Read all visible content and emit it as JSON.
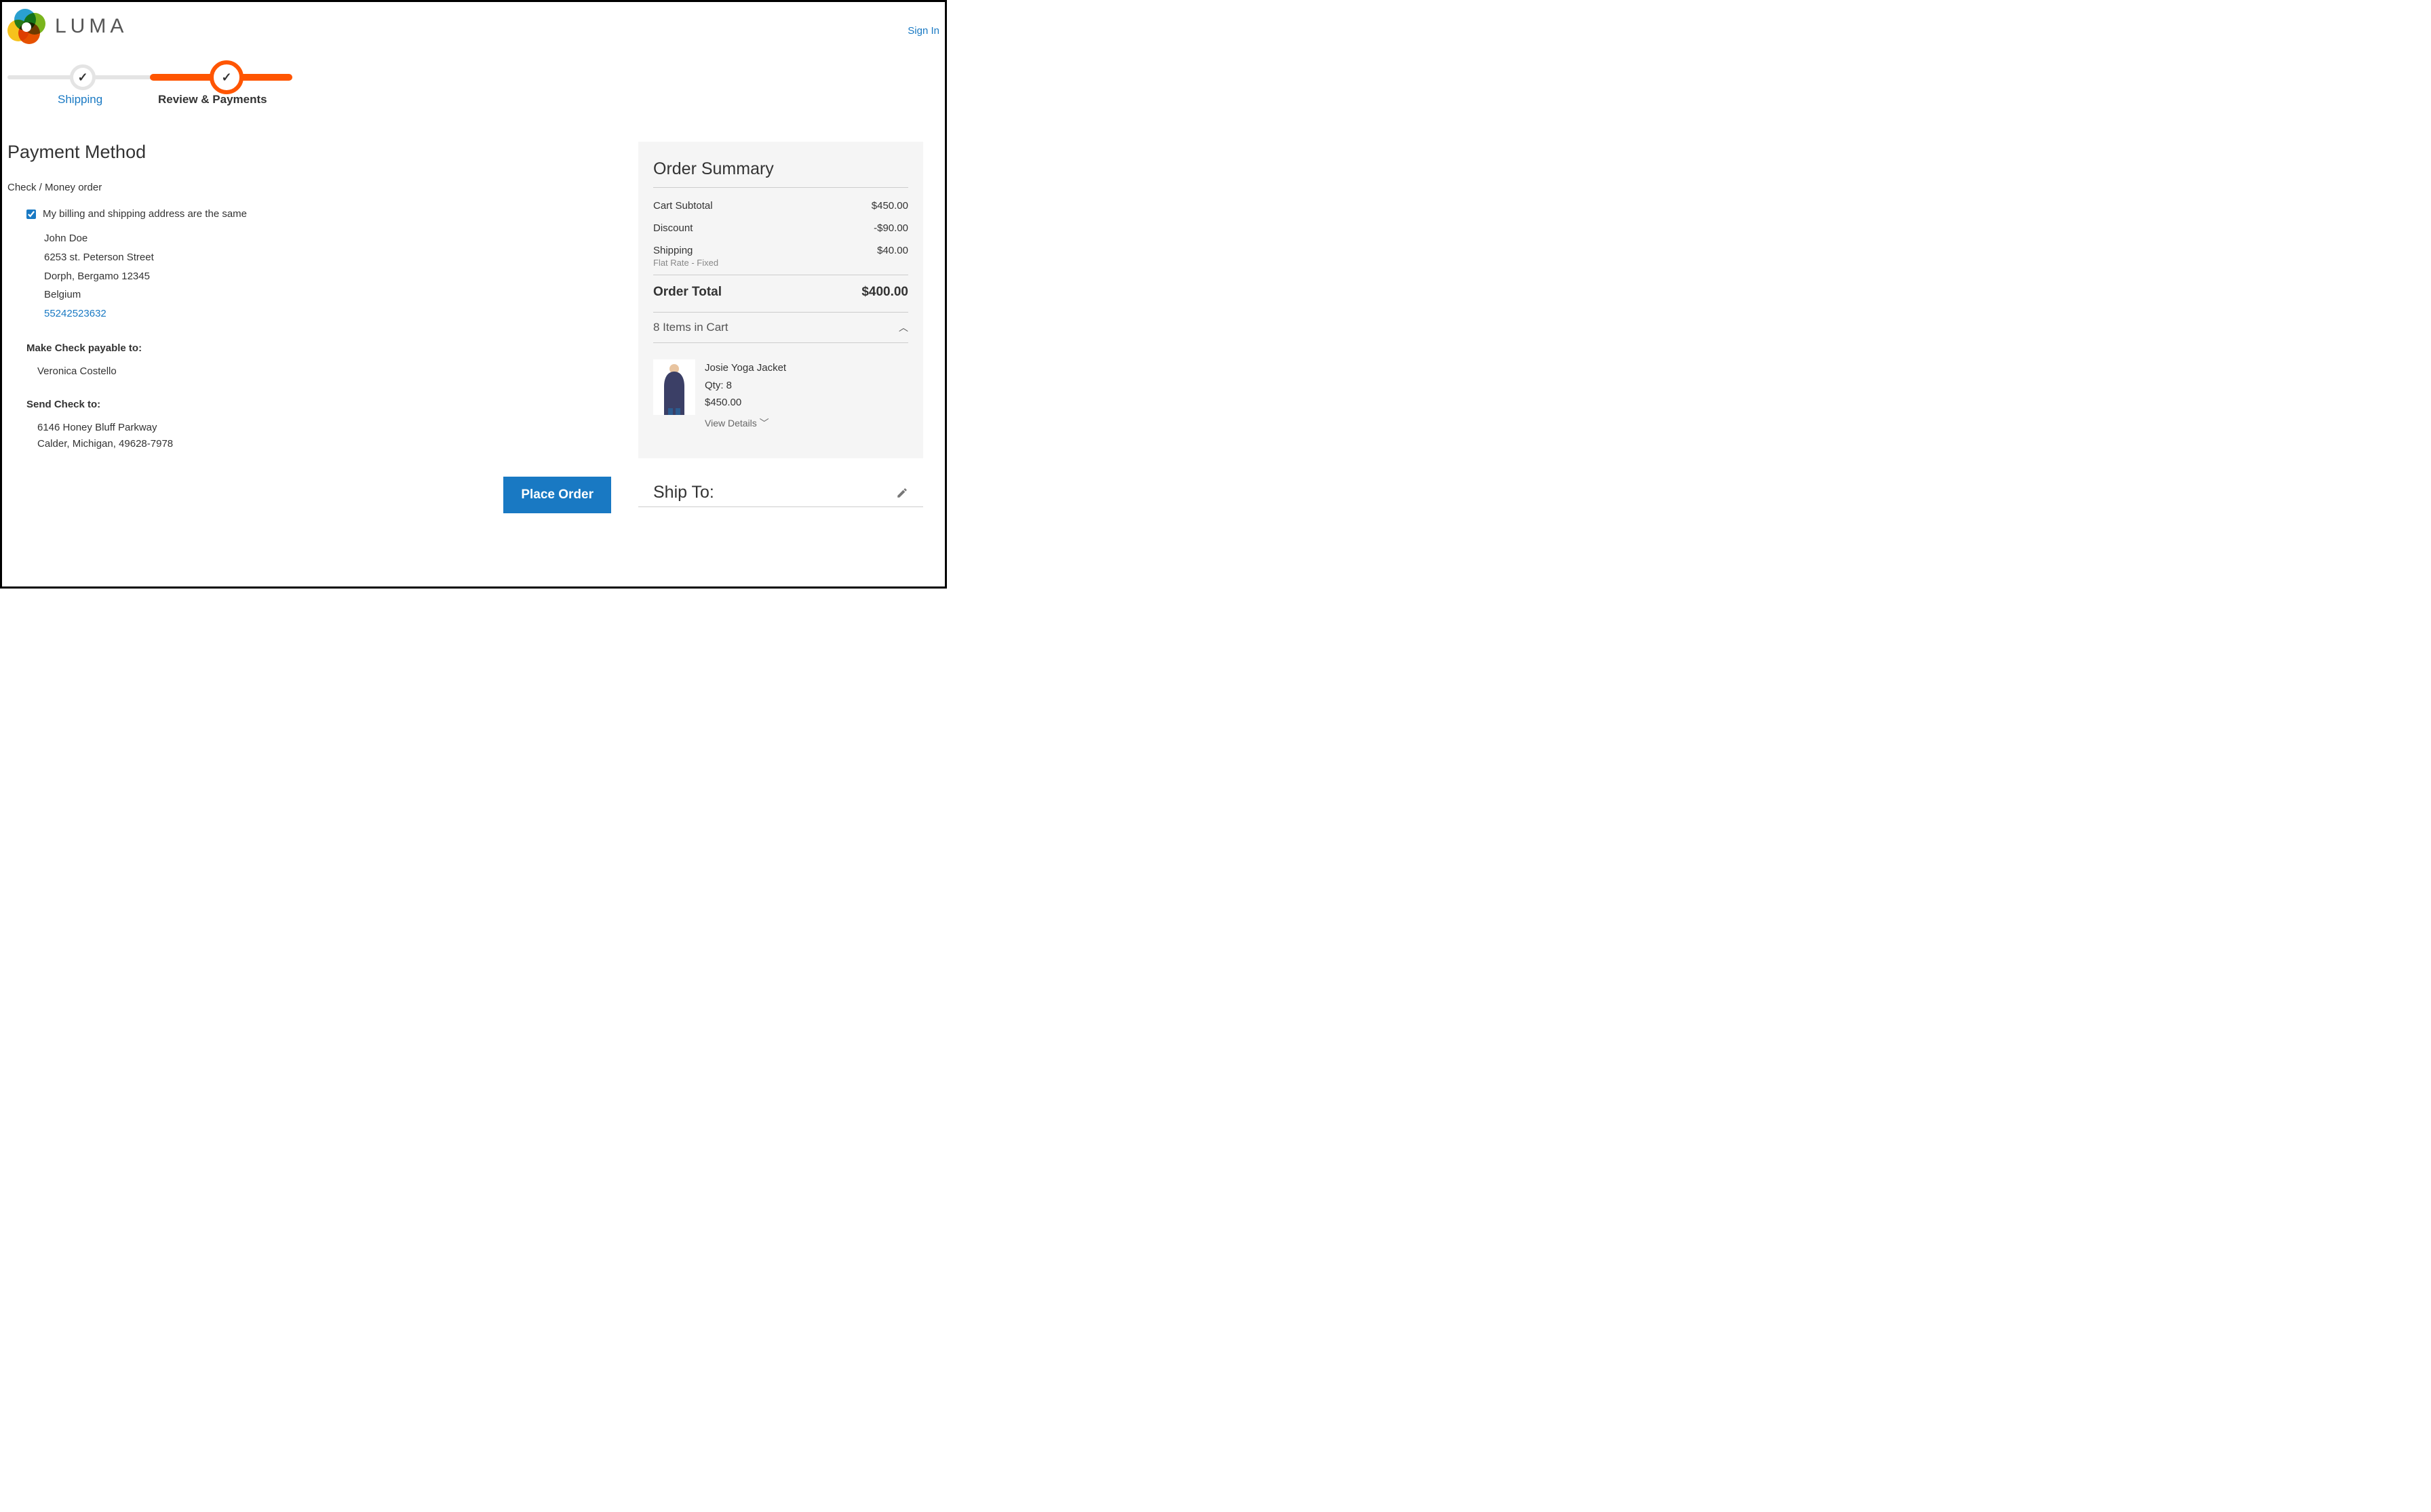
{
  "header": {
    "brand": "LUMA",
    "signin": "Sign In"
  },
  "progress": {
    "step1": "Shipping",
    "step2": "Review & Payments"
  },
  "payment": {
    "title": "Payment Method",
    "method": "Check / Money order",
    "same_address_label": "My billing and shipping address are the same",
    "address": {
      "name": "John Doe",
      "street": "6253 st. Peterson Street",
      "city_line": "Dorph, Bergamo 12345",
      "country": "Belgium",
      "phone": "55242523632"
    },
    "payable_label": "Make Check payable to:",
    "payable_value": "Veronica Costello",
    "sendto_label": "Send Check to:",
    "sendto_line1": "6146 Honey Bluff Parkway",
    "sendto_line2": "Calder, Michigan, 49628-7978",
    "place_order": "Place Order"
  },
  "summary": {
    "title": "Order Summary",
    "subtotal_label": "Cart Subtotal",
    "subtotal_value": "$450.00",
    "discount_label": "Discount",
    "discount_value": "-$90.00",
    "shipping_label": "Shipping",
    "shipping_value": "$40.00",
    "shipping_note": "Flat Rate - Fixed",
    "total_label": "Order Total",
    "total_value": "$400.00",
    "items_in_cart": "8 Items in Cart",
    "item": {
      "name": "Josie Yoga Jacket",
      "qty": "Qty: 8",
      "price": "$450.00",
      "view_details": "View Details"
    }
  },
  "shipto": {
    "title": "Ship To:"
  }
}
